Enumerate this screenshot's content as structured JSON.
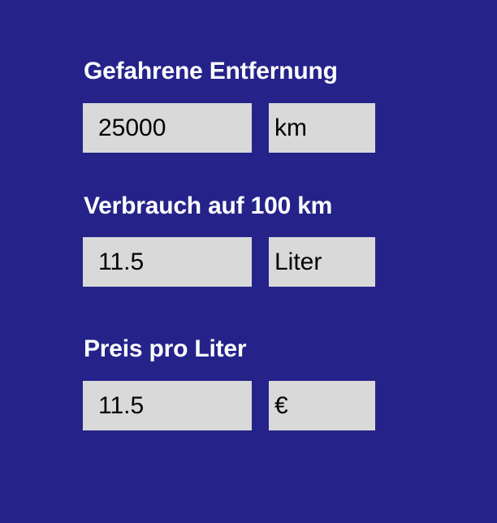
{
  "form": {
    "distance": {
      "label": "Gefahrene Entfernung",
      "value": "25000",
      "unit": "km"
    },
    "consumption": {
      "label": "Verbrauch auf 100 km",
      "value": "11.5",
      "unit": "Liter"
    },
    "price": {
      "label": "Preis pro Liter",
      "value": "11.5",
      "unit": "€"
    }
  },
  "colors": {
    "background": "#25238a",
    "field_background": "#d9d9d9",
    "label_text": "#ffffff",
    "field_text": "#000000"
  }
}
